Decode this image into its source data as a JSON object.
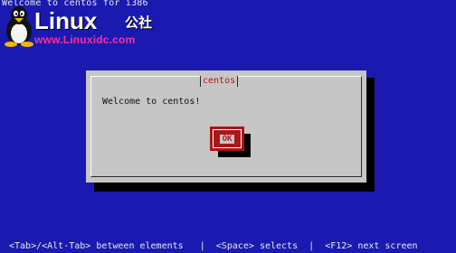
{
  "screen": {
    "title_line": "Welcome to centos for i386"
  },
  "watermark": {
    "brand": "Linux",
    "brand_cn": "公社",
    "url": "www.Linuxidc.com"
  },
  "dialog": {
    "title": "centos",
    "message": "Welcome to centos!",
    "ok_label": "OK"
  },
  "help_line": "<Tab>/<Alt-Tab> between elements   |  <Space> selects  |  <F12> next screen",
  "colors": {
    "background": "#1a1ab0",
    "dialog": "#c6c6c6",
    "accent": "#a81818",
    "watermark_url": "#ff2da0"
  }
}
